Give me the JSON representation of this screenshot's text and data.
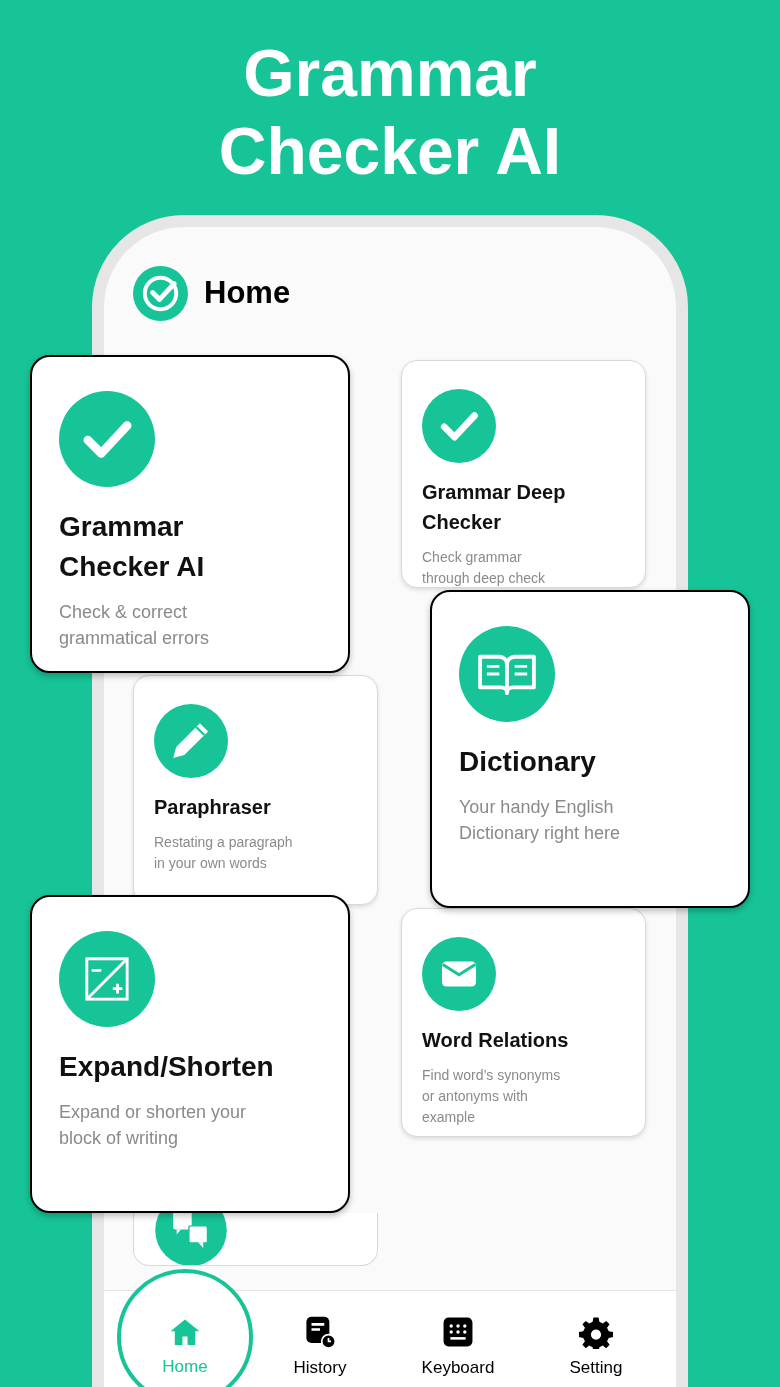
{
  "headline": "Grammar\nChecker AI",
  "app_header": {
    "title": "Home"
  },
  "grid_cards": [
    {
      "kind": "check",
      "title": "Grammar Deep\nChecker",
      "description": "Check grammar\nthrough deep check"
    },
    {
      "kind": "pencil",
      "title": "Paraphraser",
      "description": "Restating a paragraph\nin your own words"
    },
    {
      "kind": "mail",
      "title": "Word Relations",
      "description": "Find word’s synonyms\nor antonyms with\nexample"
    },
    {
      "kind": "translate"
    }
  ],
  "featured_cards": [
    {
      "kind": "check",
      "title": "Grammar\nChecker AI",
      "description": "Check & correct\ngrammatical errors"
    },
    {
      "kind": "book",
      "title": "Dictionary",
      "description": "Your handy English\nDictionary right here"
    },
    {
      "kind": "expand",
      "title": "Expand/Shorten",
      "description": "Expand or shorten your\nblock of writing"
    }
  ],
  "tabs": [
    {
      "kind": "home",
      "label": "Home",
      "selected": true
    },
    {
      "kind": "history",
      "label": "History",
      "selected": false
    },
    {
      "kind": "keyboard",
      "label": "Keyboard",
      "selected": false
    },
    {
      "kind": "gear",
      "label": "Setting",
      "selected": false
    }
  ]
}
